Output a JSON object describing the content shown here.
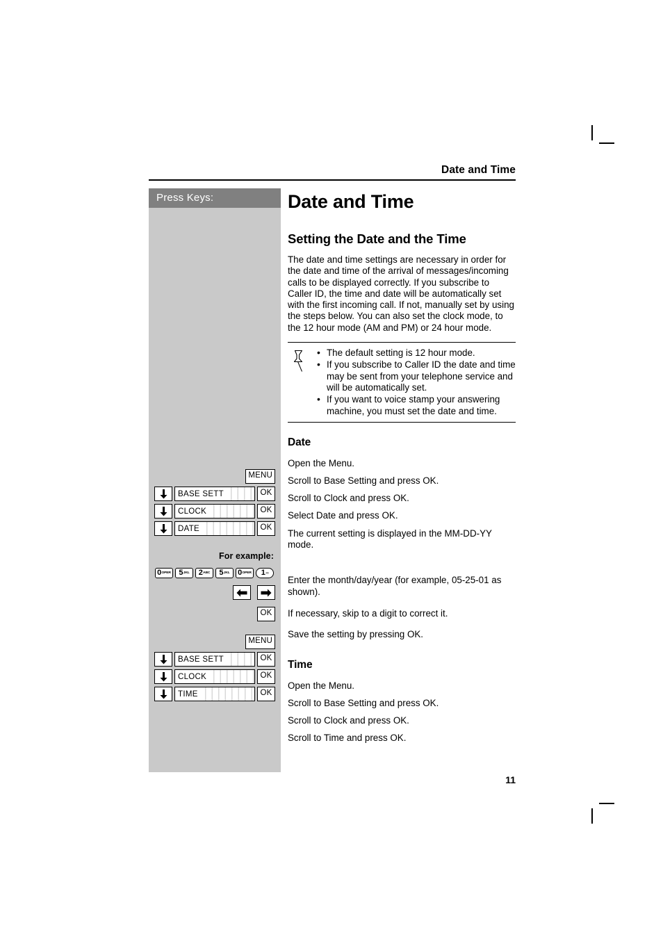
{
  "page": {
    "running_header": "Date and Time",
    "number": "11"
  },
  "sidebar": {
    "header": "Press Keys:",
    "for_example_label": "For example:",
    "arrow_down_icon": "arrow-down-icon",
    "arrow_left_icon": "arrow-left-icon",
    "arrow_right_icon": "arrow-right-icon",
    "menu_key": "MENU",
    "ok_key": "OK",
    "date_rows": [
      {
        "display": "BASE SETT",
        "key": "OK"
      },
      {
        "display": "CLOCK",
        "key": "OK"
      },
      {
        "display": "DATE",
        "key": "OK"
      }
    ],
    "time_rows": [
      {
        "display": "BASE SETT",
        "key": "OK"
      },
      {
        "display": "CLOCK",
        "key": "OK"
      },
      {
        "display": "TIME",
        "key": "OK"
      }
    ],
    "keypad": [
      {
        "digit": "0",
        "sub": "OPER"
      },
      {
        "digit": "5",
        "sub": "JKL"
      },
      {
        "digit": "2",
        "sub": "ABC"
      },
      {
        "digit": "5",
        "sub": "JKL"
      },
      {
        "digit": "0",
        "sub": "OPER"
      },
      {
        "digit": "1",
        "sub": "∞",
        "shape": "round"
      }
    ]
  },
  "main": {
    "title": "Date and Time",
    "section_title": "Setting the Date and the Time",
    "intro": "The date and time settings are necessary in order for the date and time of the arrival of messages/incoming calls to be displayed correctly. If you subscribe to Caller ID, the time and date will be automatically set with the first incoming call. If not, manually set by using the steps below. You can also set the clock mode, to the 12 hour mode (AM and PM) or 24 hour mode.",
    "note": {
      "icon": "pushpin-icon",
      "bullets": [
        "The default setting is 12 hour mode.",
        "If you subscribe to Caller ID the date and time may be sent from your telephone service and will be automatically set.",
        "If you want to voice stamp your answering machine, you must set the date and time."
      ]
    },
    "date": {
      "heading": "Date",
      "steps": [
        "Open the Menu.",
        "Scroll to Base Setting and press OK.",
        "Scroll to Clock and press OK.",
        "Select Date and press OK."
      ],
      "note_after": "The current setting is displayed in the MM-DD-YY mode.",
      "example_steps": [
        "Enter the month/day/year (for example, 05-25-01 as shown).",
        "If necessary, skip to a digit to correct it.",
        "Save the setting by pressing OK."
      ]
    },
    "time": {
      "heading": "Time",
      "steps": [
        "Open the Menu.",
        "Scroll to Base Setting and press OK.",
        "Scroll to Clock and press OK.",
        "Scroll to Time and press OK."
      ]
    }
  },
  "colors": {
    "sidebar_header_bg": "#808080",
    "sidebar_bg": "#c9c9c9",
    "text": "#000000"
  }
}
